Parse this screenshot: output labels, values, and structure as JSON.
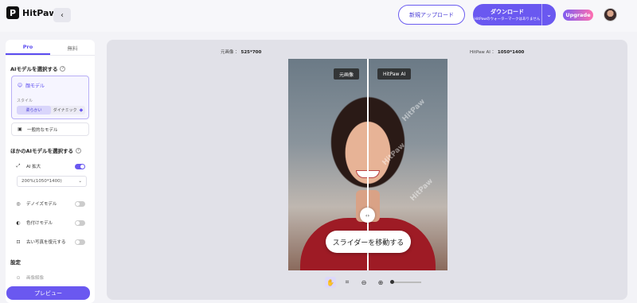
{
  "app": {
    "name": "HitPaw"
  },
  "header": {
    "new_upload": "新規アップロード",
    "download_title": "ダウンロード",
    "download_sub": "HitPawのウォーターマークはありません",
    "upgrade": "Upgrade"
  },
  "sidebar": {
    "tabs": [
      "Pro",
      "無料"
    ],
    "ai_model_title": "AIモデルを選択する",
    "model_name": "顔モデル",
    "style_label": "スタイル",
    "style_options": [
      "柔らかい",
      "ダイナミック"
    ],
    "general_model": "一般的なモデル",
    "other_ai_title": "ほかのAIモデルを選択する",
    "ai_upscale": "AI 拡大",
    "ai_upscale_on": true,
    "scale_value": "200%(1050*1400)",
    "denoise": "デノイズモデル",
    "colorize": "色付けモデル",
    "restore": "古い写真を復元する",
    "settings_title": "設定",
    "partial_item": "画像解像",
    "preview": "プレビュー"
  },
  "canvas": {
    "original_label": "元画像 ：",
    "original_size": "525*700",
    "ai_label": "HitPaw AI ：",
    "ai_size": "1050*1400",
    "chip_original": "元画像",
    "chip_ai": "HitPaw AI",
    "slider_tip": "スライダーを移動する",
    "watermark": "HitPaw",
    "zoom_level": 0
  },
  "colors": {
    "accent": "#6a58f0",
    "shirt": "#9e1b25"
  }
}
